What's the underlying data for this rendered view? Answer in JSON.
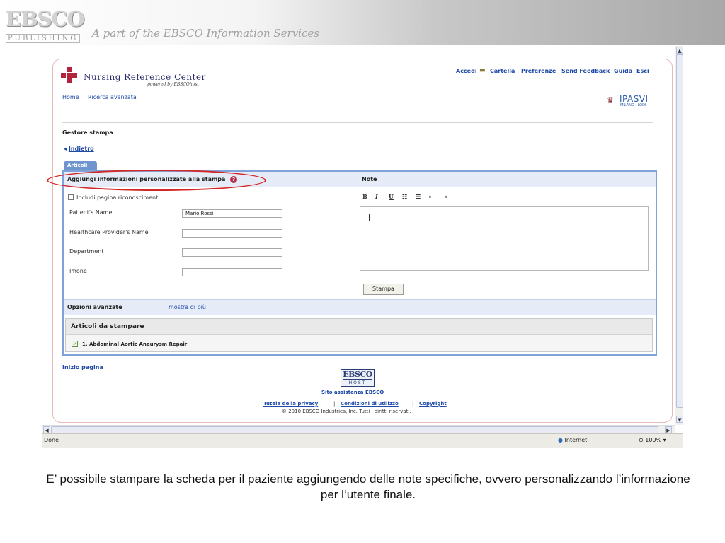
{
  "banner": {
    "logo_main": "EBSCO",
    "logo_sub": "PUBLISHING",
    "tagline": "A part of the EBSCO Information Services"
  },
  "header": {
    "brand": "Nursing Reference Center",
    "powered_by": "powered by EBSCOhost",
    "top_links": [
      "Accedi",
      "Cartella",
      "Preferenze",
      "Send Feedback",
      "Guida",
      "Esci"
    ],
    "nav_links": [
      "Home",
      "Ricerca avanzata"
    ],
    "partner_logo": "IPASVI",
    "partner_sub": "MILANO · LODI"
  },
  "page": {
    "title": "Gestore stampa",
    "back_label": "Indietro",
    "tab_label": "Articoli"
  },
  "custom_info": {
    "header": "Aggiungi informazioni personalizzate alla stampa",
    "ack_label": "Includi pagina riconoscimenti",
    "fields": [
      {
        "label": "Patient's Name",
        "value": "Mario Rossi"
      },
      {
        "label": "Healthcare Provider's Name",
        "value": ""
      },
      {
        "label": "Department",
        "value": ""
      },
      {
        "label": "Phone",
        "value": ""
      }
    ]
  },
  "notes": {
    "header": "Note",
    "toolbar": [
      "B",
      "I",
      "U",
      "☷",
      "☰",
      "⇤",
      "⇥"
    ]
  },
  "stampa_button": "Stampa",
  "advanced": {
    "label": "Opzioni avanzate",
    "link": "mostra di più"
  },
  "articles": {
    "header": "Articoli da stampare",
    "items": [
      "1. Abdominal Aortic Aneurysm Repair"
    ]
  },
  "footer": {
    "top_link": "Inizio pagina",
    "host_logo_top": "EBSCO",
    "host_logo_bottom": "HOST",
    "support": "Sito assistenza EBSCO",
    "privacy": "Tutela della privacy",
    "terms": "Condizioni di utilizzo",
    "copyright_link": "Copyright",
    "copyright_text": "© 2010 EBSCO Industries, Inc. Tutti i diritti riservati."
  },
  "statusbar": {
    "status": "Done",
    "zone": "Internet",
    "zoom": "100%"
  },
  "caption": "E’ possibile stampare la scheda per il paziente aggiungendo delle note specifiche, ovvero personalizzando l’informazione per l’utente finale.",
  "colors": {
    "link": "#1f4aa8",
    "panel_border": "#7fa3d8",
    "highlight": "#d42828",
    "brand": "#b3243c"
  }
}
